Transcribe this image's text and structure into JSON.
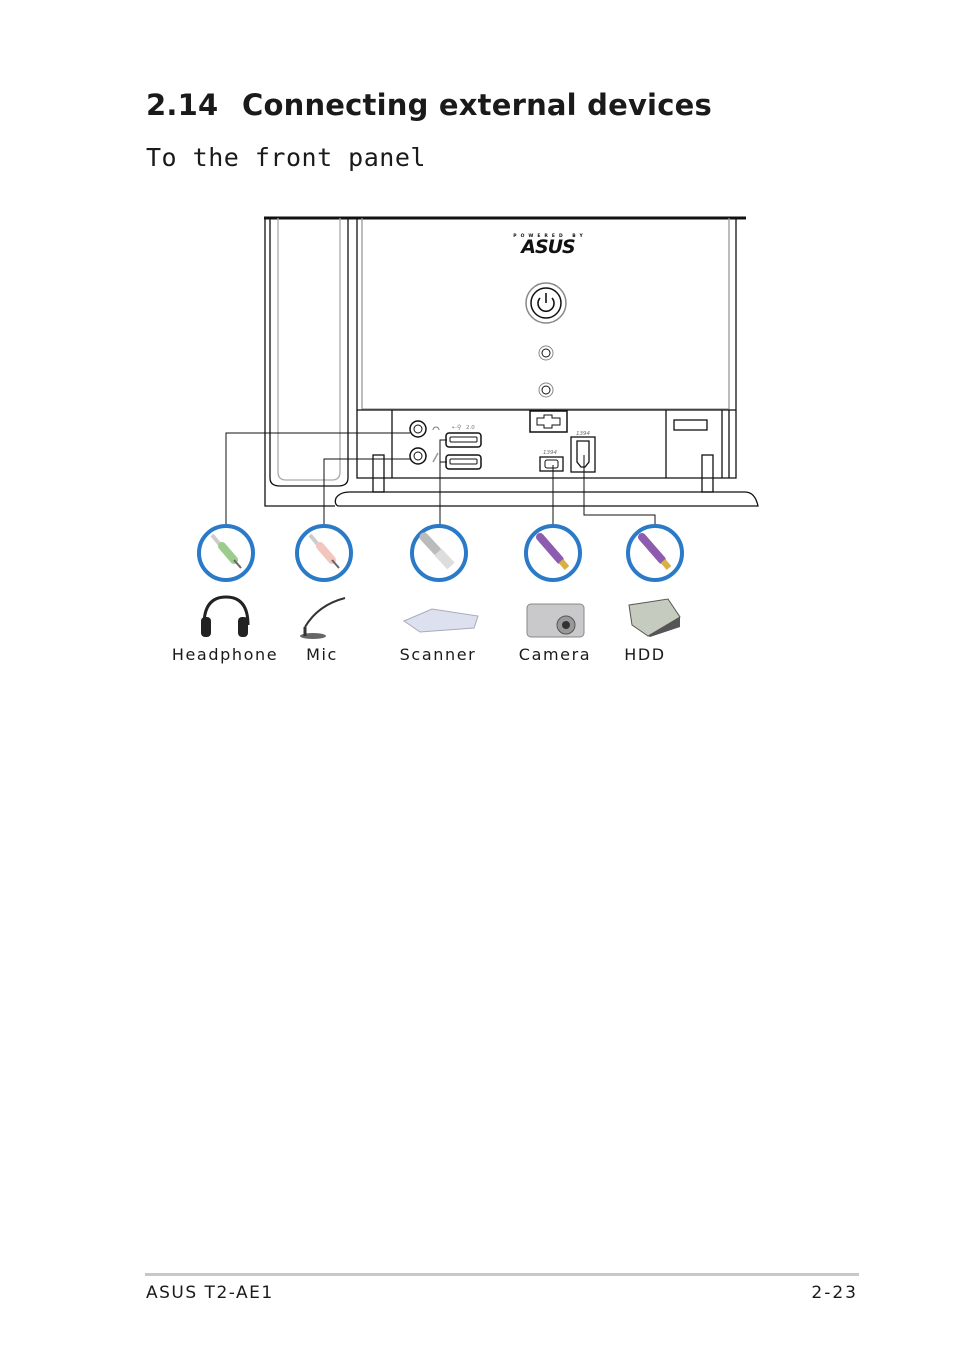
{
  "section": {
    "number": "2.14",
    "title": "Connecting external devices"
  },
  "subsection": {
    "title": "To the front panel"
  },
  "diagram": {
    "logo_text": "POWERED BY ASUS",
    "usb_label": "2.0",
    "firewire_small_label": "1394",
    "firewire_large_label": "1394",
    "accent_color": "#2a7ac8",
    "devices": [
      {
        "label": "Headphone",
        "icon": "headphone-icon",
        "plug": "green-audio-plug"
      },
      {
        "label": "Mic",
        "icon": "microphone-icon",
        "plug": "pink-audio-plug"
      },
      {
        "label": "Scanner",
        "icon": "scanner-icon",
        "plug": "usb-plug"
      },
      {
        "label": "Camera",
        "icon": "camera-icon",
        "plug": "firewire-plug"
      },
      {
        "label": "HDD",
        "icon": "hard-drive-icon",
        "plug": "firewire-plug"
      }
    ]
  },
  "footer": {
    "product": "ASUS T2-AE1",
    "page": "2-23"
  }
}
